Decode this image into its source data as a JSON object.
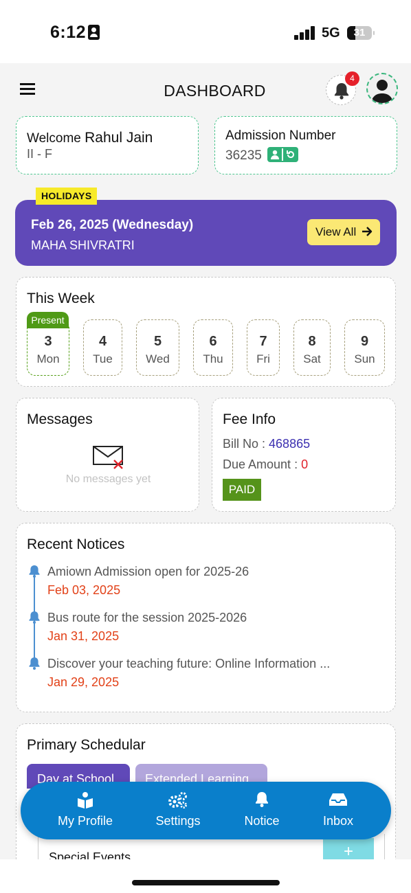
{
  "status_bar": {
    "time": "6:12",
    "network": "5G",
    "battery": "31"
  },
  "header": {
    "title": "DASHBOARD",
    "notification_count": "4"
  },
  "welcome": {
    "label": "Welcome",
    "name": "Rahul Jain",
    "class": "II - F"
  },
  "admission": {
    "label": "Admission Number",
    "number": "36235"
  },
  "holidays": {
    "tag": "HOLIDAYS",
    "date": "Feb 26, 2025 (Wednesday)",
    "name": "MAHA SHIVRATRI",
    "view_all": "View All"
  },
  "this_week": {
    "title": "This Week",
    "present_label": "Present",
    "days": [
      {
        "num": "3",
        "name": "Mon"
      },
      {
        "num": "4",
        "name": "Tue"
      },
      {
        "num": "5",
        "name": "Wed"
      },
      {
        "num": "6",
        "name": "Thu"
      },
      {
        "num": "7",
        "name": "Fri"
      },
      {
        "num": "8",
        "name": "Sat"
      },
      {
        "num": "9",
        "name": "Sun"
      }
    ]
  },
  "messages": {
    "title": "Messages",
    "empty_text": "No messages yet"
  },
  "fee_info": {
    "title": "Fee Info",
    "bill_label": "Bill No :",
    "bill_no": "468865",
    "due_label": "Due Amount :",
    "due_amount": "0",
    "status": "PAID"
  },
  "notices": {
    "title": "Recent Notices",
    "items": [
      {
        "text": "Amiown Admission open for 2025-26",
        "date": "Feb 03, 2025"
      },
      {
        "text": "Bus route for the session 2025-2026",
        "date": "Jan 31, 2025"
      },
      {
        "text": "Discover your teaching future: Online Information ...",
        "date": "Jan 29, 2025"
      }
    ]
  },
  "schedule": {
    "title": "Primary Schedular",
    "tabs": [
      "Day at School",
      "Extended Learning"
    ],
    "special_events": "Special Events",
    "add": "+"
  },
  "bottom_nav": [
    {
      "label": "My Profile",
      "icon": "book-reader-icon"
    },
    {
      "label": "Settings",
      "icon": "gears-icon"
    },
    {
      "label": "Notice",
      "icon": "bell-icon"
    },
    {
      "label": "Inbox",
      "icon": "inbox-icon"
    }
  ],
  "colors": {
    "primary_purple": "#6049b8",
    "nav_blue": "#0a7fcb",
    "accent_green": "#2fb178",
    "holiday_tag": "#f7ea2a",
    "date_red": "#e24118"
  }
}
